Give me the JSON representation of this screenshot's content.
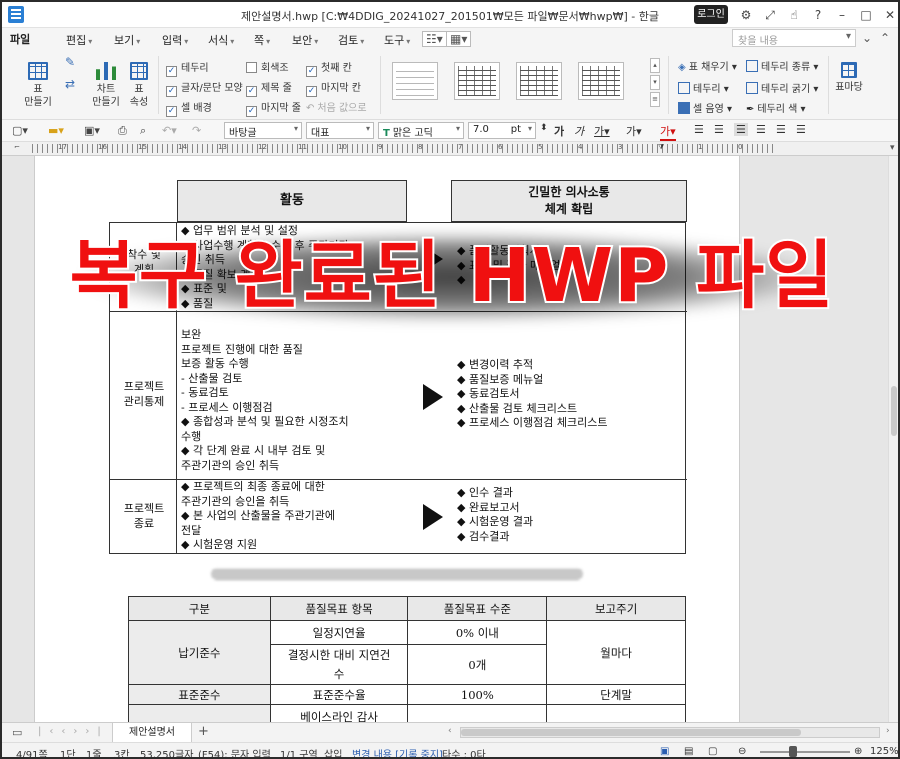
{
  "window": {
    "title": "제안설명서.hwp [C:₩4DDIG_20241027_201501₩모든 파일₩문서₩hwp₩] - 한글",
    "login_label": "로그인",
    "controls": [
      "⚙",
      "⤢",
      "☝",
      "?",
      "–",
      "□",
      "✕"
    ]
  },
  "menu": {
    "file": "파일",
    "items": [
      "편집",
      "보기",
      "입력",
      "서식",
      "쪽",
      "보안",
      "검토",
      "도구"
    ],
    "search_placeholder": "찾을 내용"
  },
  "ribbon": {
    "table_create": {
      "line1": "표",
      "line2": "만들기"
    },
    "chart_create": {
      "line1": "차트",
      "line2": "만들기"
    },
    "table_props": {
      "line1": "표",
      "line2": "속성"
    },
    "checks_col1": [
      {
        "label": "테두리",
        "checked": true
      },
      {
        "label": "글자/문단 모양",
        "checked": true
      },
      {
        "label": "셀 배경",
        "checked": true
      }
    ],
    "checks_col2": [
      {
        "label": "회색조",
        "checked": false
      },
      {
        "label": "제목 줄",
        "checked": true
      },
      {
        "label": "마지막 줄",
        "checked": true
      }
    ],
    "checks_col3": [
      {
        "label": "첫째 칸",
        "checked": true
      },
      {
        "label": "마지막 칸",
        "checked": true
      },
      {
        "label": "처음 값으로",
        "checked": false
      }
    ],
    "right_col1": [
      "표 채우기",
      "테두리",
      "셀 음영"
    ],
    "right_col2": [
      "테두리 종류",
      "테두리 굵기",
      "테두리 색"
    ],
    "table_frame": "표마당"
  },
  "format": {
    "style": "바탕글",
    "lang": "대표",
    "font": "맑은 고딕",
    "size": "7.0",
    "unit": "pt"
  },
  "ruler_labels": [
    "17",
    "16",
    "15",
    "14",
    "13",
    "12",
    "11",
    "10",
    "9",
    "8",
    "7",
    "6",
    "5",
    "4",
    "3",
    "2",
    "1",
    "0",
    "1",
    "2",
    "3",
    "4",
    "5",
    "6",
    "7",
    "8",
    "9",
    "10",
    "11",
    "12",
    "13",
    "14",
    "15",
    "16",
    "17",
    "18",
    "19",
    "20",
    "21",
    "22"
  ],
  "document": {
    "header_activity": "활동",
    "header_right_line1": "긴밀한 의사소통",
    "header_right_line2": "체계 확립",
    "row1_label_line1": "착수 및",
    "row1_label_line2": "계획",
    "row1_bullets": [
      "◆ 업무 범위 분석 및 설정",
      "◆ 사업수행 계획을 수립 후 주관기관",
      "   승인 취득",
      "◆ 품질 확보 계획",
      "◆ 표준 및",
      "◆ 품질"
    ],
    "row1_right": [
      "◆ 품질활동계획서",
      "◆ 표준 및 절차 매뉴얼",
      "◆"
    ],
    "row2_label_line1": "프로젝트",
    "row2_label_line2": "관리통제",
    "row2_bullets": [
      "   보완",
      "   프로젝트 진행에 대한 품질",
      "   보증 활동 수행",
      "- 산출물 검토",
      "- 동료검토",
      "- 프로세스 이행점검",
      "◆ 종합성과 분석 및 필요한 시정조치",
      "   수행",
      "◆ 각 단계 완료 시 내부 검토 및",
      "   주관기관의 승인 취득"
    ],
    "row2_right": [
      "◆ 변경이력 추적",
      "◆ 품질보증 메뉴얼",
      "◆ 동료검토서",
      "◆ 산출물 검토 체크리스트",
      "◆ 프로세스 이행점검 체크리스트"
    ],
    "row3_label_line1": "프로젝트",
    "row3_label_line2": "종료",
    "row3_bullets": [
      "◆ 프로젝트의 최종 종료에 대한",
      "   주관기관의 승인을 취득",
      "◆ 본 사업의 산출물을 주관기관에",
      "   전달",
      "◆ 시험운영 지원"
    ],
    "row3_right": [
      "◆ 인수 결과",
      "◆ 완료보고서",
      "◆ 시험운영 결과",
      "◆ 검수결과"
    ],
    "overlay_text": "복구 완료된 HWP 파일",
    "quality_table": {
      "headers": [
        "구분",
        "품질목표 항목",
        "품질목표 수준",
        "보고주기"
      ],
      "rows": [
        {
          "cat": "납기준수",
          "item": "일정지연율",
          "level": "0% 이내",
          "period": "월마다"
        },
        {
          "cat": "",
          "item": "결정시한 대비 지연건수",
          "level": "0개",
          "period": ""
        },
        {
          "cat": "표준준수",
          "item": "표준준수율",
          "level": "100%",
          "period": "단계말"
        },
        {
          "cat": "",
          "item": "베이스라인 감사",
          "level": "",
          "period": ""
        }
      ]
    }
  },
  "tabs": {
    "active": "제안설명서",
    "add": "+"
  },
  "status": {
    "page": "4/91쪽",
    "section": "1단",
    "line": "1줄",
    "col": "3칸",
    "chars": "53,250글자",
    "mode": "(F54): 문자 입력",
    "zone": "1/1 구역",
    "insert": "삽입",
    "track": "변경 내용 [기록 중지]",
    "typo": "타수 : 0타",
    "zoom": "125%"
  }
}
